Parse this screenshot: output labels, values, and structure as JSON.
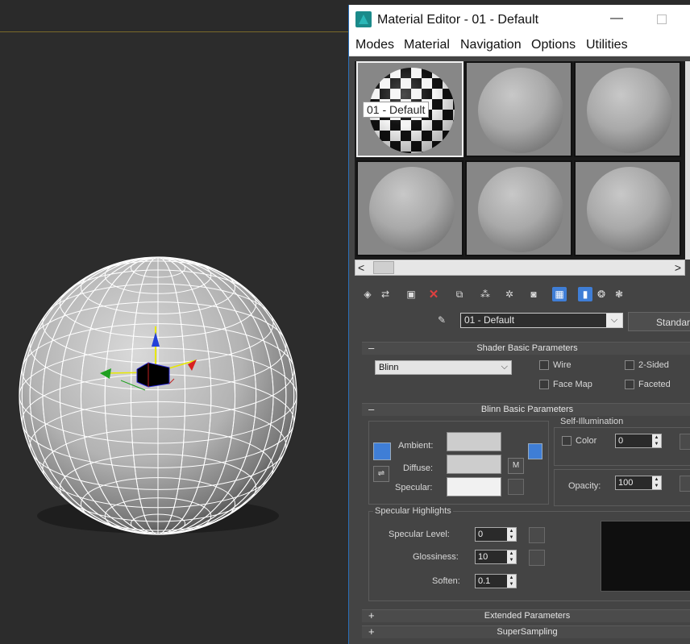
{
  "window": {
    "title": "Material Editor - 01 - Default",
    "minimize_label": "—"
  },
  "menu": [
    "Modes",
    "Material",
    "Navigation",
    "Options",
    "Utilities"
  ],
  "slots": {
    "active_label": "01 - Default"
  },
  "scroll": {
    "left": "<",
    "right": ">"
  },
  "name_row": {
    "material_name": "01 - Default",
    "type_button": "Standard"
  },
  "shader_rollout": {
    "title": "Shader Basic Parameters",
    "collapse": "–",
    "shader": "Blinn",
    "wire": "Wire",
    "two_sided": "2-Sided",
    "face_map": "Face Map",
    "faceted": "Faceted"
  },
  "blinn_rollout": {
    "title": "Blinn Basic Parameters",
    "collapse": "–",
    "ambient": "Ambient:",
    "diffuse": "Diffuse:",
    "specular": "Specular:",
    "m_button": "M",
    "self_illum_title": "Self-Illumination",
    "color_label": "Color",
    "self_illum_value": "0",
    "opacity_label": "Opacity:",
    "opacity_value": "100",
    "spec_highlights_title": "Specular Highlights",
    "spec_level_label": "Specular Level:",
    "spec_level_value": "0",
    "glossiness_label": "Glossiness:",
    "glossiness_value": "10",
    "soften_label": "Soften:",
    "soften_value": "0.1"
  },
  "extended_rollout": {
    "title": "Extended Parameters",
    "expand": "+"
  },
  "supersampling_rollout": {
    "title": "SuperSampling",
    "expand": "+"
  },
  "colors": {
    "accent": "#3f7ed6",
    "panel_bg": "#444444",
    "viewport_bg": "#2c2c2c"
  }
}
